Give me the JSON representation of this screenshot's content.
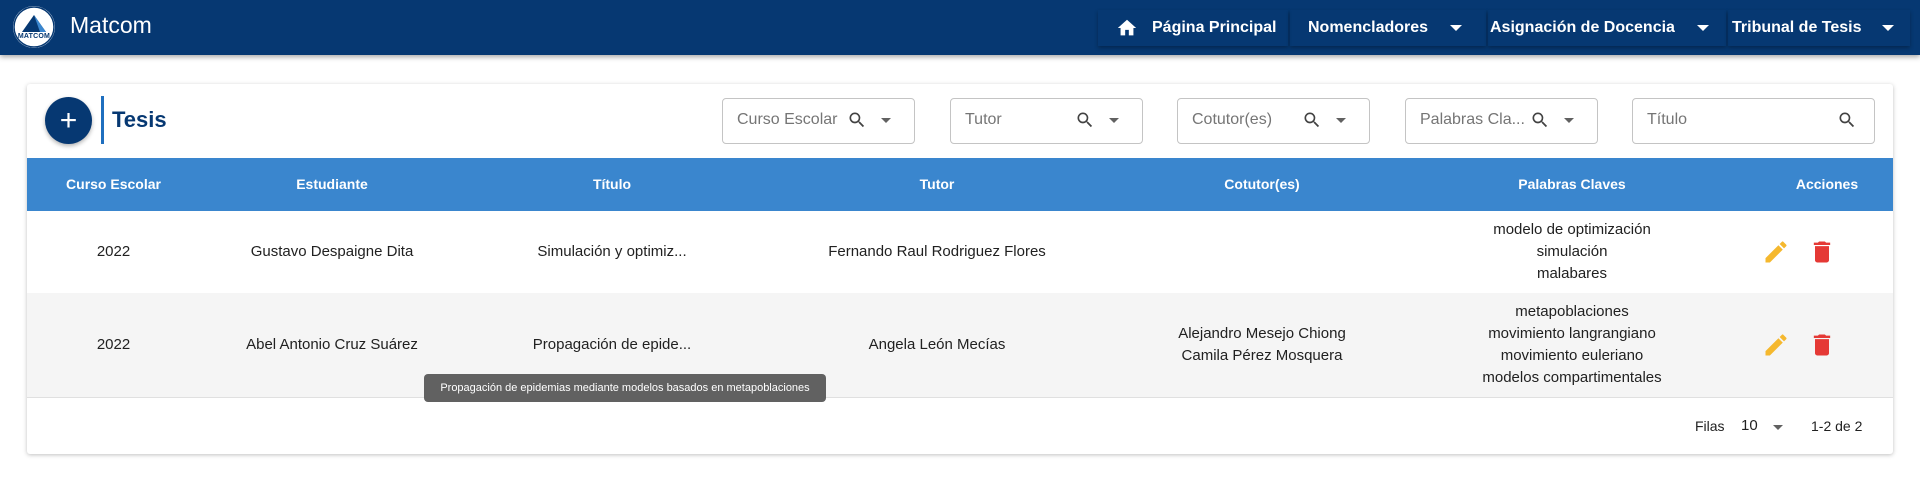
{
  "header": {
    "logo_text": "MATCOM",
    "brand": "Matcom",
    "nav": [
      {
        "label": "Página Principal",
        "icon": "home-icon"
      },
      {
        "label": "Nomencladores"
      },
      {
        "label": "Asignación de Docencia"
      },
      {
        "label": "Tribunal de Tesis"
      }
    ]
  },
  "page": {
    "title": "Tesis",
    "add_label": "+"
  },
  "filters": [
    {
      "placeholder": "Curso Escolar"
    },
    {
      "placeholder": "Tutor"
    },
    {
      "placeholder": "Cotutor(es)"
    },
    {
      "placeholder": "Palabras Cla..."
    },
    {
      "placeholder": "Título"
    }
  ],
  "table": {
    "columns": [
      "Curso Escolar",
      "Estudiante",
      "Título",
      "Tutor",
      "Cotutor(es)",
      "Palabras Claves",
      "Acciones"
    ],
    "rows": [
      {
        "curso": "2022",
        "estudiante": "Gustavo Despaigne Dita",
        "titulo": "Simulación y optimiz...",
        "tutor": "Fernando Raul Rodriguez Flores",
        "cotutores": [],
        "palabras": [
          "modelo de optimización",
          "simulación",
          "malabares"
        ]
      },
      {
        "curso": "2022",
        "estudiante": "Abel Antonio Cruz Suárez",
        "titulo": "Propagación de epide...",
        "tutor": "Angela León Mecías",
        "cotutores": [
          "Alejandro Mesejo Chiong",
          "Camila Pérez Mosquera"
        ],
        "palabras": [
          "metapoblaciones",
          "movimiento langrangiano",
          "movimiento euleriano",
          "modelos compartimentales"
        ]
      }
    ]
  },
  "tooltip": "Propagación de epidemias mediante modelos basados en metapoblaciones",
  "pagination": {
    "rows_label": "Filas",
    "rows_value": "10",
    "range": "1-2 de 2"
  },
  "colors": {
    "navbar": "#063872",
    "table_header": "#3a86ce",
    "edit": "#f5b82e",
    "delete": "#e53935"
  }
}
